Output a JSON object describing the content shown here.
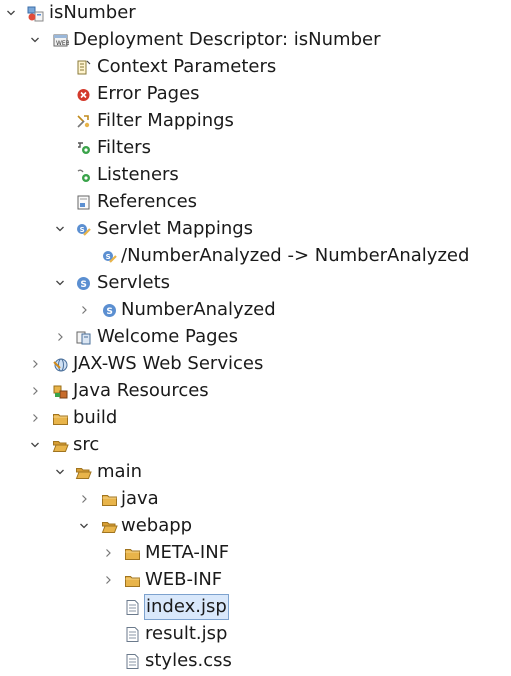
{
  "tree": {
    "items": [
      {
        "label": "isNumber",
        "icon": "web-project-icon",
        "expander": "expanded"
      },
      {
        "label": "Deployment Descriptor: isNumber",
        "icon": "deployment-descriptor-icon",
        "expander": "expanded"
      },
      {
        "label": "Context Parameters",
        "icon": "context-parameters-icon",
        "expander": "none"
      },
      {
        "label": "Error Pages",
        "icon": "error-pages-icon",
        "expander": "none"
      },
      {
        "label": "Filter Mappings",
        "icon": "filter-mappings-icon",
        "expander": "none"
      },
      {
        "label": "Filters",
        "icon": "filters-icon",
        "expander": "none"
      },
      {
        "label": "Listeners",
        "icon": "listeners-icon",
        "expander": "none"
      },
      {
        "label": "References",
        "icon": "references-icon",
        "expander": "none"
      },
      {
        "label": "Servlet Mappings",
        "icon": "servlet-mappings-icon",
        "expander": "expanded"
      },
      {
        "label": "/NumberAnalyzed -> NumberAnalyzed",
        "icon": "servlet-mapping-icon",
        "expander": "none"
      },
      {
        "label": "Servlets",
        "icon": "servlets-icon",
        "expander": "expanded"
      },
      {
        "label": "NumberAnalyzed",
        "icon": "servlet-icon",
        "expander": "collapsed"
      },
      {
        "label": "Welcome Pages",
        "icon": "welcome-pages-icon",
        "expander": "collapsed"
      },
      {
        "label": "JAX-WS Web Services",
        "icon": "jax-ws-icon",
        "expander": "collapsed"
      },
      {
        "label": "Java Resources",
        "icon": "java-resources-icon",
        "expander": "collapsed"
      },
      {
        "label": "build",
        "icon": "folder-icon",
        "expander": "collapsed"
      },
      {
        "label": "src",
        "icon": "folder-open-icon",
        "expander": "expanded"
      },
      {
        "label": "main",
        "icon": "folder-open-icon",
        "expander": "expanded"
      },
      {
        "label": "java",
        "icon": "folder-icon",
        "expander": "collapsed"
      },
      {
        "label": "webapp",
        "icon": "folder-open-icon",
        "expander": "expanded"
      },
      {
        "label": "META-INF",
        "icon": "folder-icon",
        "expander": "collapsed"
      },
      {
        "label": "WEB-INF",
        "icon": "folder-icon",
        "expander": "collapsed"
      },
      {
        "label": "index.jsp",
        "icon": "jsp-file-icon",
        "expander": "none",
        "selected": true
      },
      {
        "label": "result.jsp",
        "icon": "jsp-file-icon",
        "expander": "none"
      },
      {
        "label": "styles.css",
        "icon": "css-file-icon",
        "expander": "none"
      }
    ]
  },
  "colors": {
    "selection_bg": "#d9e8fb",
    "selection_border": "#7da2ce",
    "folder": "#e8b44a",
    "servlet_blue": "#5b8fd1",
    "error_red": "#d33a2c"
  }
}
